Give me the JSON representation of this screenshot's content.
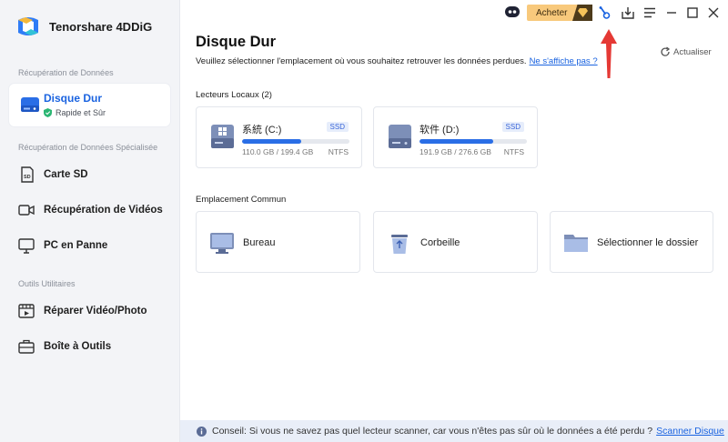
{
  "app": {
    "name": "Tenorshare 4DDiG"
  },
  "sidebar": {
    "section_recovery": "Récupération de Données",
    "active_item": {
      "label": "Disque Dur",
      "sublabel": "Rapide et Sûr"
    },
    "section_specialized": "Récupération de Données Spécialisée",
    "specialized_items": [
      {
        "label": "Carte SD",
        "icon": "sd-card-icon"
      },
      {
        "label": "Récupération de Vidéos",
        "icon": "video-icon"
      },
      {
        "label": "PC en Panne",
        "icon": "monitor-icon"
      }
    ],
    "section_tools": "Outils Utilitaires",
    "tool_items": [
      {
        "label": "Réparer Vidéo/Photo",
        "icon": "repair-icon"
      },
      {
        "label": "Boîte à Outils",
        "icon": "toolbox-icon"
      }
    ]
  },
  "titlebar": {
    "buy_label": "Acheter"
  },
  "main": {
    "title": "Disque Dur",
    "subtitle": "Veuillez sélectionner l'emplacement où vous souhaitez retrouver les données perdues.",
    "subtitle_link": "Ne s'affiche pas ?",
    "refresh_label": "Actualiser",
    "local_drives_heading": "Lecteurs Locaux (2)",
    "drives": [
      {
        "name": "系統 (C:)",
        "badge": "SSD",
        "size": "110.0 GB / 199.4 GB",
        "fs": "NTFS",
        "used_fraction": 0.55
      },
      {
        "name": "软件 (D:)",
        "badge": "SSD",
        "size": "191.9 GB / 276.6 GB",
        "fs": "NTFS",
        "used_fraction": 0.69
      }
    ],
    "common_heading": "Emplacement Commun",
    "locations": [
      {
        "label": "Bureau",
        "icon": "desktop-icon"
      },
      {
        "label": "Corbeille",
        "icon": "recycle-bin-icon"
      },
      {
        "label": "Sélectionner le dossier",
        "icon": "folder-icon"
      }
    ]
  },
  "tip": {
    "text": "Conseil: Si vous ne savez pas quel lecteur scanner, car vous n'êtes pas sûr où le données a été perdu ?",
    "link": "Scanner Disque"
  },
  "colors": {
    "accent": "#1a63e0",
    "buy": "#f8c97c",
    "arrow": "#e53935"
  }
}
